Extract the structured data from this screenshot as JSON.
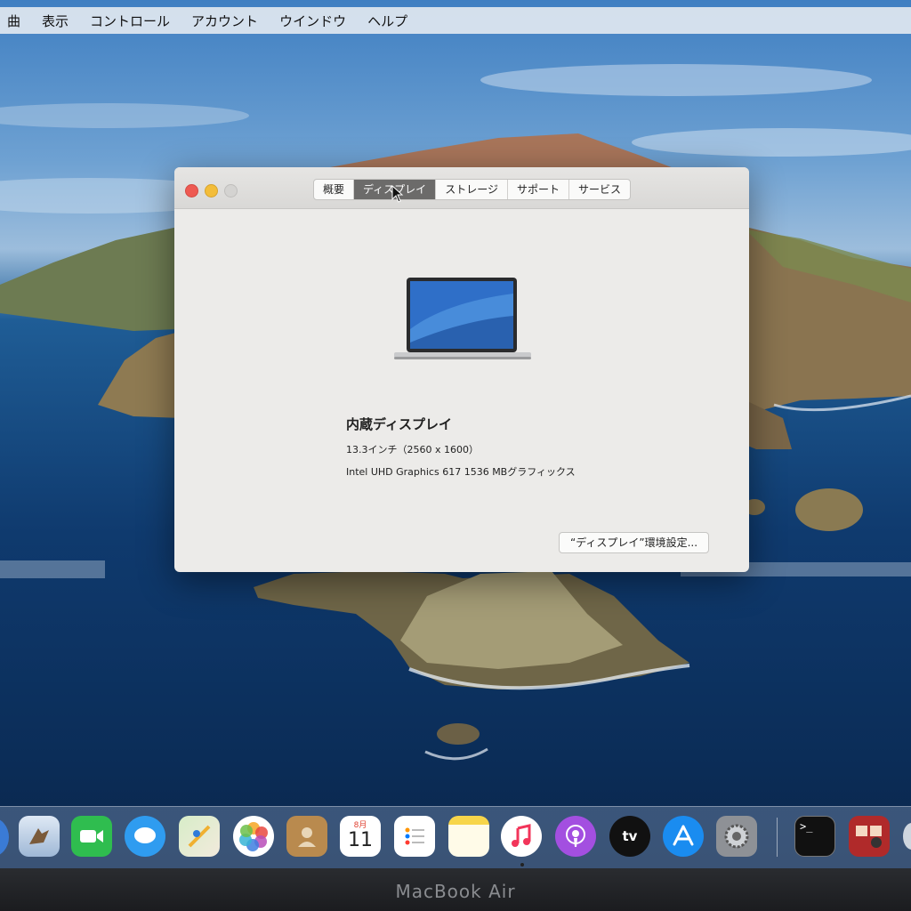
{
  "menubar": {
    "items": [
      "曲",
      "表示",
      "コントロール",
      "アカウント",
      "ウインドウ",
      "ヘルプ"
    ]
  },
  "window": {
    "tabs": [
      {
        "label": "概要",
        "active": false
      },
      {
        "label": "ディスプレイ",
        "active": true
      },
      {
        "label": "ストレージ",
        "active": false
      },
      {
        "label": "サポート",
        "active": false
      },
      {
        "label": "サービス",
        "active": false
      }
    ],
    "display": {
      "name": "内蔵ディスプレイ",
      "size": "13.3インチ（2560 x 1600）",
      "graphics": "Intel UHD Graphics 617 1536 MBグラフィックス"
    },
    "prefs_button": "“ディスプレイ”環境設定..."
  },
  "dock": {
    "apps": [
      {
        "icon": "mail-icon"
      },
      {
        "icon": "facetime-icon"
      },
      {
        "icon": "messages-icon"
      },
      {
        "icon": "maps-icon"
      },
      {
        "icon": "photos-icon"
      },
      {
        "icon": "contacts-icon"
      },
      {
        "icon": "calendar-icon",
        "month": "8月",
        "day": "11"
      },
      {
        "icon": "reminders-icon"
      },
      {
        "icon": "notes-icon"
      },
      {
        "icon": "music-icon"
      },
      {
        "icon": "podcasts-icon"
      },
      {
        "icon": "tv-icon",
        "label": "tv"
      },
      {
        "icon": "app-store-icon"
      },
      {
        "icon": "system-preferences-icon"
      },
      {
        "icon": "terminal-icon"
      },
      {
        "icon": "photo-booth-icon"
      }
    ]
  },
  "bezel_label": "MacBook Air",
  "colors": {
    "close": "#ee5a52",
    "minimize": "#f3bd3a",
    "active_tab": "#6c6b6a"
  }
}
